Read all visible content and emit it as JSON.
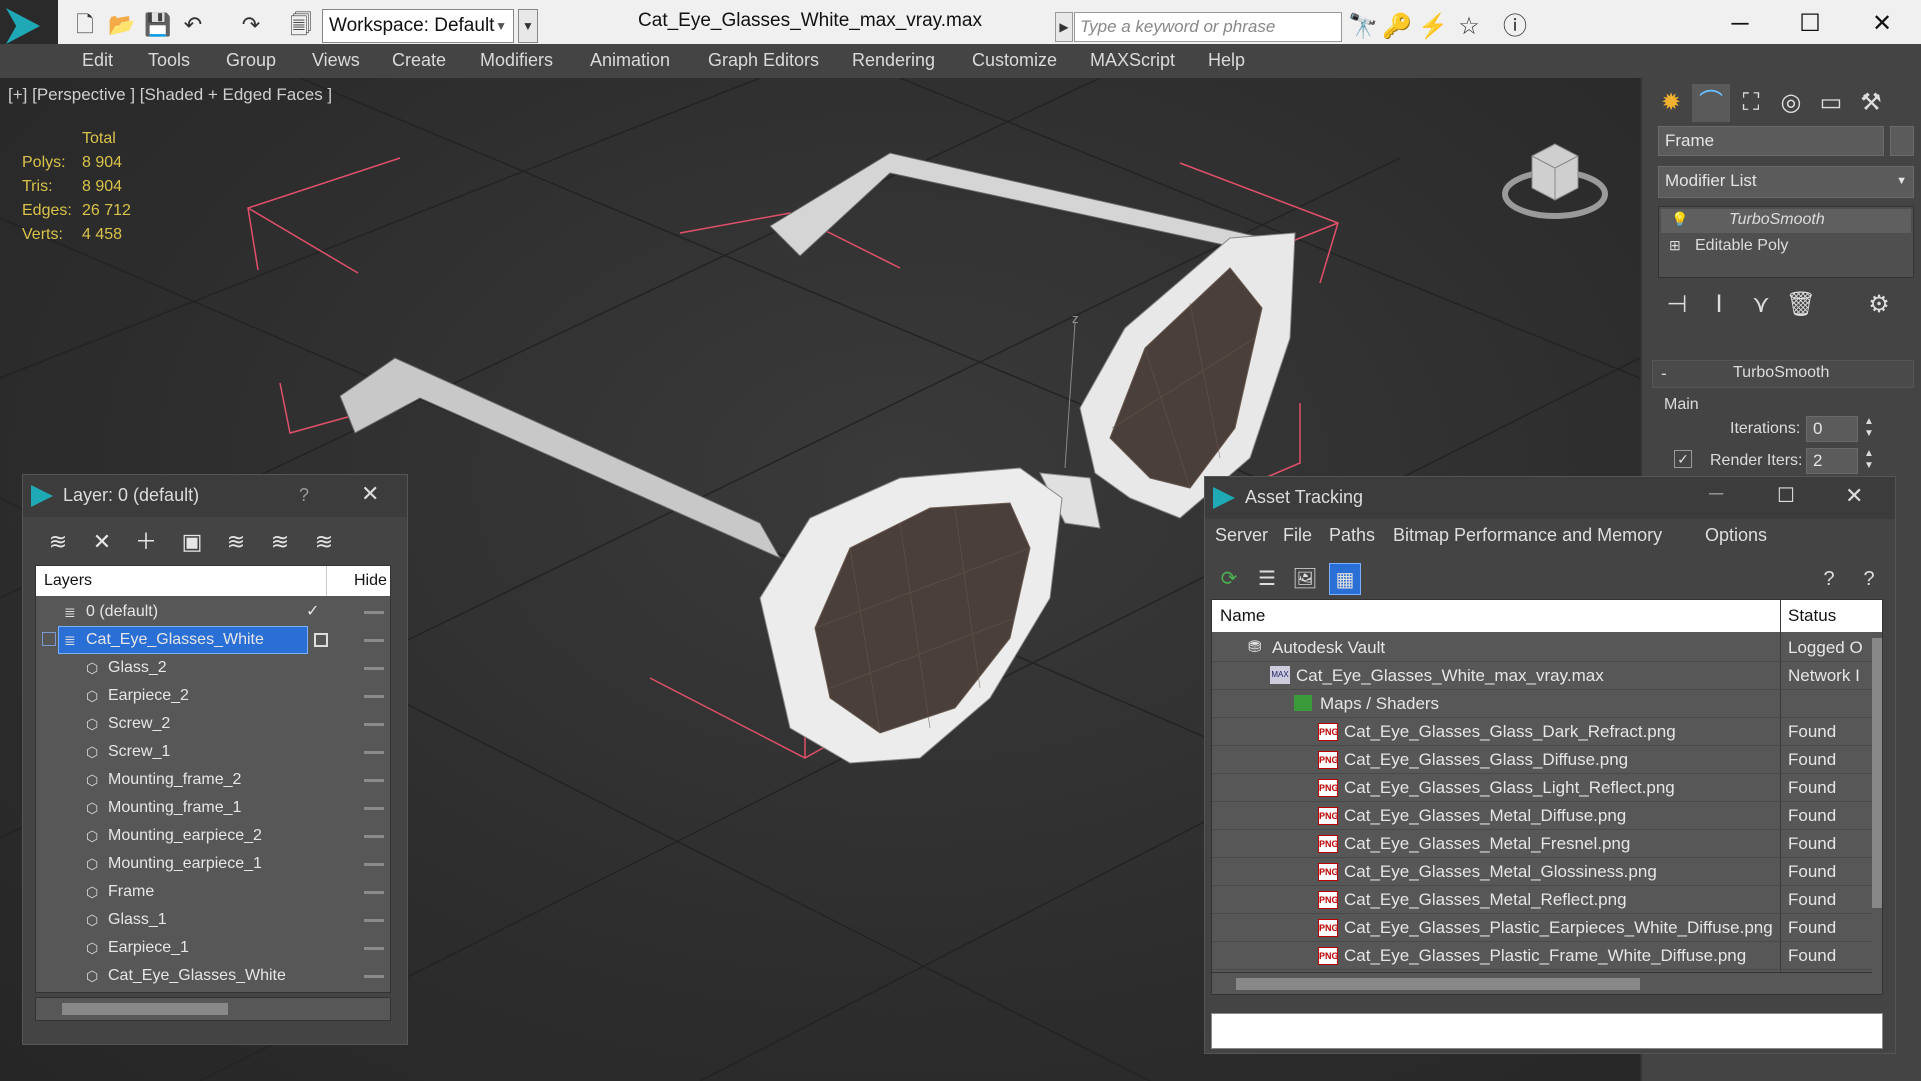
{
  "title_bar": {
    "workspace_label": "Workspace: Default",
    "window_title": "Cat_Eye_Glasses_White_max_vray.max",
    "search_placeholder": "Type a keyword or phrase"
  },
  "menu": [
    "Edit",
    "Tools",
    "Group",
    "Views",
    "Create",
    "Modifiers",
    "Animation",
    "Graph Editors",
    "Rendering",
    "Customize",
    "MAXScript",
    "Help"
  ],
  "viewport": {
    "label": "[+] [Perspective ] [Shaded + Edged Faces ]",
    "stats_header": "Total",
    "stats": [
      {
        "label": "Polys:",
        "value": "8 904"
      },
      {
        "label": "Tris:",
        "value": "8 904"
      },
      {
        "label": "Edges:",
        "value": "26 712"
      },
      {
        "label": "Verts:",
        "value": "4 458"
      }
    ],
    "axis_label": "z"
  },
  "command_panel": {
    "object_name": "Frame",
    "modifier_list_label": "Modifier List",
    "stack": [
      "TurboSmooth",
      "Editable Poly"
    ],
    "rollout_title": "TurboSmooth",
    "rollout_minus": "-",
    "group_main": "Main",
    "iterations_label": "Iterations:",
    "iterations_value": "0",
    "render_iters_label": "Render Iters:",
    "render_iters_value": "2"
  },
  "layer_window": {
    "title": "Layer: 0 (default)",
    "help": "?",
    "col_layers": "Layers",
    "col_hide": "Hide",
    "rows": [
      {
        "name": "0 (default)"
      },
      {
        "name": "Cat_Eye_Glasses_White"
      },
      {
        "name": "Glass_2"
      },
      {
        "name": "Earpiece_2"
      },
      {
        "name": "Screw_2"
      },
      {
        "name": "Screw_1"
      },
      {
        "name": "Mounting_frame_2"
      },
      {
        "name": "Mounting_frame_1"
      },
      {
        "name": "Mounting_earpiece_2"
      },
      {
        "name": "Mounting_earpiece_1"
      },
      {
        "name": "Frame"
      },
      {
        "name": "Glass_1"
      },
      {
        "name": "Earpiece_1"
      },
      {
        "name": "Cat_Eye_Glasses_White"
      }
    ]
  },
  "asset_window": {
    "title": "Asset Tracking",
    "menu": [
      "Server",
      "File",
      "Paths",
      "Bitmap Performance and Memory",
      "Options"
    ],
    "col_name": "Name",
    "col_status": "Status",
    "rows": [
      {
        "name": "Autodesk Vault",
        "status": "Logged O"
      },
      {
        "name": "Cat_Eye_Glasses_White_max_vray.max",
        "status": "Network I"
      },
      {
        "name": "Maps / Shaders",
        "status": ""
      },
      {
        "name": "Cat_Eye_Glasses_Glass_Dark_Refract.png",
        "status": "Found"
      },
      {
        "name": "Cat_Eye_Glasses_Glass_Diffuse.png",
        "status": "Found"
      },
      {
        "name": "Cat_Eye_Glasses_Glass_Light_Reflect.png",
        "status": "Found"
      },
      {
        "name": "Cat_Eye_Glasses_Metal_Diffuse.png",
        "status": "Found"
      },
      {
        "name": "Cat_Eye_Glasses_Metal_Fresnel.png",
        "status": "Found"
      },
      {
        "name": "Cat_Eye_Glasses_Metal_Glossiness.png",
        "status": "Found"
      },
      {
        "name": "Cat_Eye_Glasses_Metal_Reflect.png",
        "status": "Found"
      },
      {
        "name": "Cat_Eye_Glasses_Plastic_Earpieces_White_Diffuse.png",
        "status": "Found"
      },
      {
        "name": "Cat_Eye_Glasses_Plastic_Frame_White_Diffuse.png",
        "status": "Found"
      }
    ]
  },
  "colors": {
    "accent": "#1fa8b5",
    "selection": "#2a6fd6",
    "stats": "#d9c24a",
    "bbox": "#e0506a"
  }
}
